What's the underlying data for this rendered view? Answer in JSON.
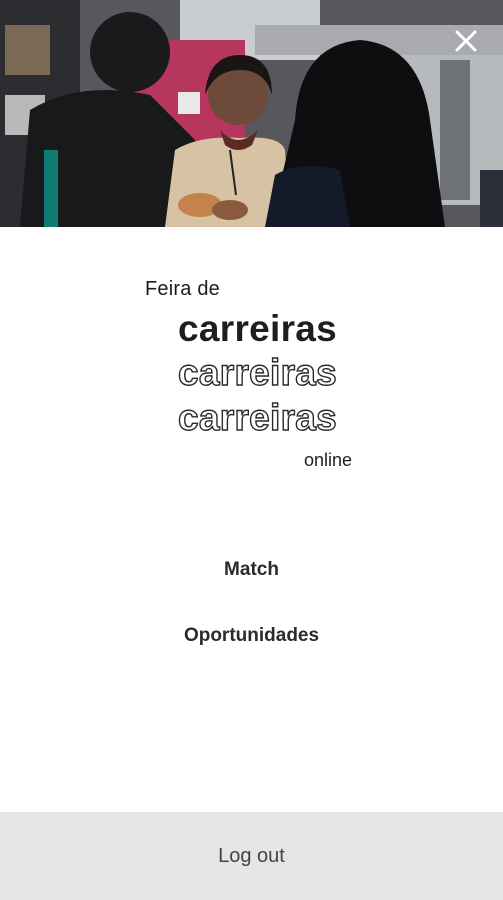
{
  "header": {
    "photo_description_icon": "career-fair-photo",
    "close_icon": "close-icon"
  },
  "logo": {
    "prefix": "Feira de",
    "main": "carreiras",
    "outline_1": "carreiras",
    "outline_2": "carreiras",
    "suffix": "online"
  },
  "menu": {
    "items": [
      {
        "label": "Match"
      },
      {
        "label": "Oportunidades"
      }
    ]
  },
  "footer": {
    "logout_label": "Log out"
  },
  "colors": {
    "text_dark": "#1e1e1e",
    "footer_bg": "#e5e5e5"
  }
}
